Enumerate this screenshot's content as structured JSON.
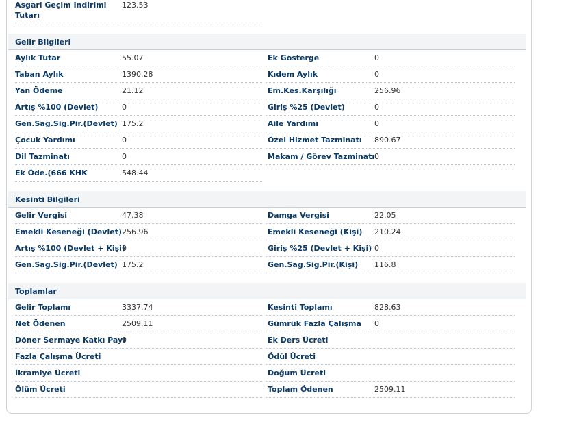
{
  "top": {
    "label_line1": "Asgari Geçim İndirimi",
    "label_line2": "Tutarı",
    "value": "123.53"
  },
  "sections": [
    {
      "title": "Gelir Bilgileri",
      "rows": [
        [
          {
            "label": "Aylık Tutar",
            "value": "55.07"
          },
          {
            "label": "Ek Gösterge",
            "value": "0"
          }
        ],
        [
          {
            "label": "Taban Aylık",
            "value": "1390.28"
          },
          {
            "label": "Kıdem Aylık",
            "value": "0"
          }
        ],
        [
          {
            "label": "Yan Ödeme",
            "value": "21.12"
          },
          {
            "label": "Em.Kes.Karşılığı",
            "value": "256.96"
          }
        ],
        [
          {
            "label": "Artış %100 (Devlet)",
            "value": "0"
          },
          {
            "label": "Giriş %25 (Devlet)",
            "value": "0"
          }
        ],
        [
          {
            "label": "Gen.Sag.Sig.Pir.(Devlet)",
            "value": "175.2"
          },
          {
            "label": "Aile Yardımı",
            "value": "0"
          }
        ],
        [
          {
            "label": "Çocuk Yardımı",
            "value": "0"
          },
          {
            "label": "Özel Hizmet Tazminatı",
            "value": "890.67"
          }
        ],
        [
          {
            "label": "Dil Tazminatı",
            "value": "0"
          },
          {
            "label": "Makam / Görev Tazminatı",
            "value": "0"
          }
        ],
        [
          {
            "label": "Ek Öde.(666 KHK",
            "value": "548.44"
          },
          null
        ]
      ]
    },
    {
      "title": "Kesinti Bilgileri",
      "rows": [
        [
          {
            "label": "Gelir Vergisi",
            "value": "47.38"
          },
          {
            "label": "Damga Vergisi",
            "value": "22.05"
          }
        ],
        [
          {
            "label": "Emekli Keseneği (Devlet)",
            "value": "256.96"
          },
          {
            "label": "Emekli Keseneği (Kişi)",
            "value": "210.24"
          }
        ],
        [
          {
            "label": "Artış %100 (Devlet + Kişi)",
            "value": "0"
          },
          {
            "label": "Giriş %25 (Devlet + Kişi)",
            "value": "0"
          }
        ],
        [
          {
            "label": "Gen.Sag.Sig.Pir.(Devlet)",
            "value": "175.2"
          },
          {
            "label": "Gen.Sag.Sig.Pir.(Kişi)",
            "value": "116.8"
          }
        ]
      ]
    },
    {
      "title": "Toplamlar",
      "rows": [
        [
          {
            "label": "Gelir Toplamı",
            "value": "3337.74"
          },
          {
            "label": "Kesinti Toplamı",
            "value": "828.63"
          }
        ],
        [
          {
            "label": "Net Ödenen",
            "value": "2509.11"
          },
          {
            "label": "Gümrük Fazla Çalışma",
            "value": "0"
          }
        ],
        [
          {
            "label": "Döner Sermaye Katkı Payı",
            "value": "0"
          },
          {
            "label": "Ek Ders Ücreti",
            "value": ""
          }
        ],
        [
          {
            "label": "Fazla Çalışma Ücreti",
            "value": ""
          },
          {
            "label": "Ödül Ücreti",
            "value": ""
          }
        ],
        [
          {
            "label": "İkramiye Ücreti",
            "value": ""
          },
          {
            "label": "Doğum Ücreti",
            "value": ""
          }
        ],
        [
          {
            "label": "Ölüm Ücreti",
            "value": ""
          },
          {
            "label": "Toplam Ödenen",
            "value": "2509.11"
          }
        ]
      ]
    }
  ]
}
